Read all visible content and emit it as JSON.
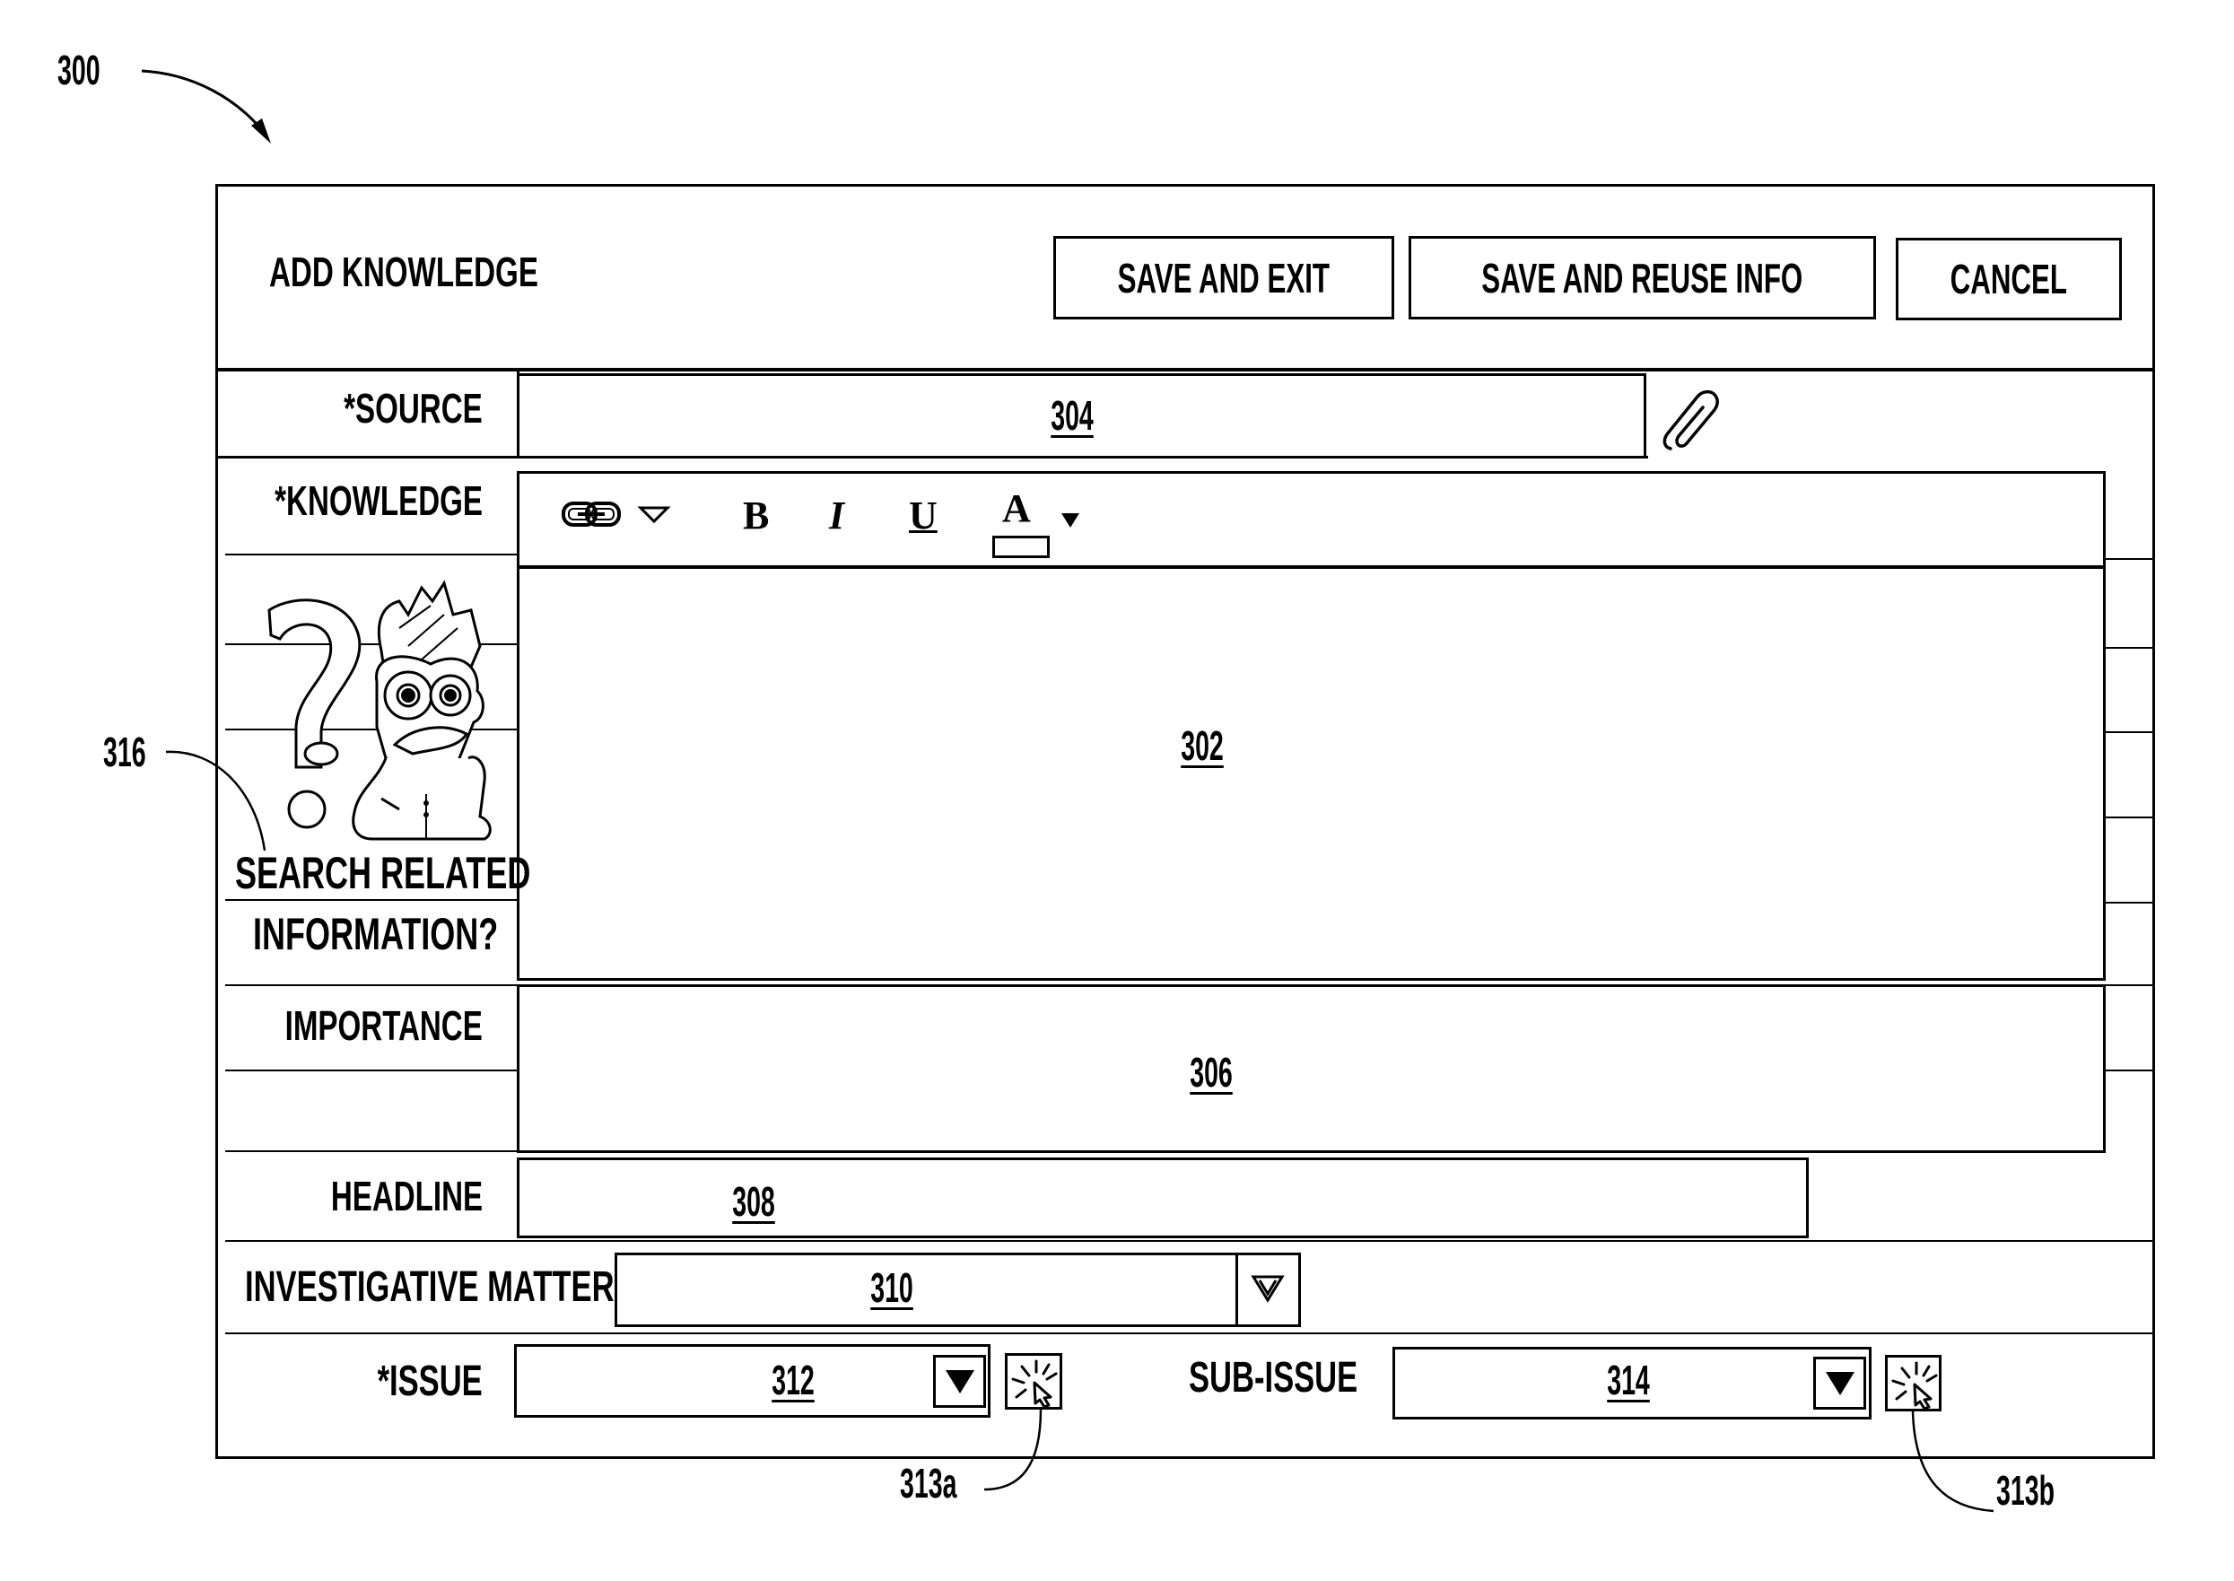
{
  "figure": {
    "ref_main": "300",
    "ref_mascot": "316",
    "ref_issue_icon": "313a",
    "ref_subissue_icon": "313b"
  },
  "header": {
    "title": "ADD KNOWLEDGE",
    "buttons": {
      "save_exit": "SAVE AND EXIT",
      "save_reuse": "SAVE AND REUSE INFO",
      "cancel": "CANCEL"
    }
  },
  "form": {
    "source": {
      "label": "*SOURCE",
      "ref": "304",
      "attach_icon": "paperclip-icon"
    },
    "knowledge": {
      "label": "*KNOWLEDGE",
      "ref": "302",
      "toolbar": {
        "link_icon": "link-icon",
        "bold": "B",
        "italic": "I",
        "underline": "U",
        "font_color": "A"
      }
    },
    "search_related": {
      "line1": "SEARCH RELATED",
      "line2": "INFORMATION?",
      "mascot_icon": "mascot-question-icon"
    },
    "importance": {
      "label": "IMPORTANCE",
      "ref": "306"
    },
    "headline": {
      "label": "HEADLINE",
      "ref": "308"
    },
    "investigative_matter": {
      "label": "INVESTIGATIVE MATTER",
      "ref": "310"
    },
    "issue": {
      "label": "*ISSUE",
      "ref": "312",
      "click_icon": "cursor-click-icon"
    },
    "sub_issue": {
      "label": "SUB-ISSUE",
      "ref": "314",
      "click_icon": "cursor-click-icon"
    }
  }
}
